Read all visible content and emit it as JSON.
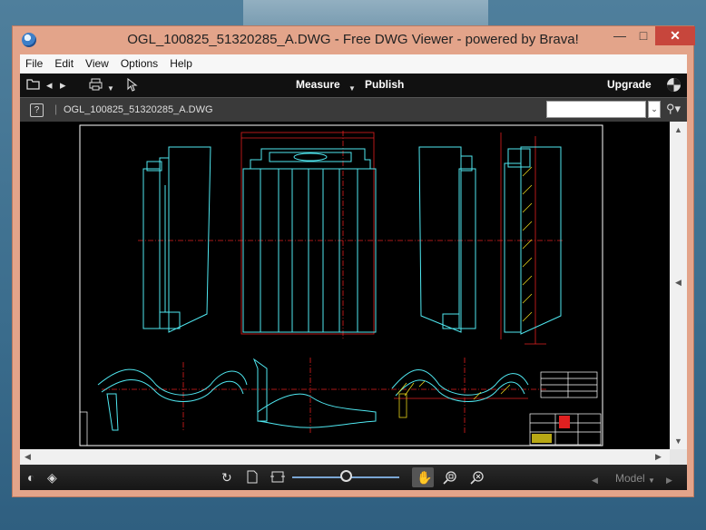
{
  "window": {
    "title": "OGL_100825_51320285_A.DWG - Free DWG Viewer - powered by Brava!",
    "controls": {
      "minimize": "—",
      "maximize": "□",
      "close": "✕"
    }
  },
  "menu": [
    "File",
    "Edit",
    "View",
    "Options",
    "Help"
  ],
  "toolbar": {
    "measure_label": "Measure",
    "publish_label": "Publish",
    "upgrade_label": "Upgrade",
    "icons": [
      "open-folder-icon",
      "back-arrow-icon",
      "forward-arrow-icon",
      "print-icon",
      "pointer-icon",
      "brava-logo-icon"
    ]
  },
  "doc_bar": {
    "filename": "OGL_100825_51320285_A.DWG",
    "search": {
      "value": "",
      "placeholder": ""
    }
  },
  "bottom_bar": {
    "model_label": "Model",
    "zoom_fraction": 0.5,
    "icons": [
      "contrast-icon",
      "layers-icon",
      "rotate-icon",
      "page-icon",
      "fit-icon",
      "pan-hand-icon",
      "zoom-window-icon",
      "zoom-extents-icon"
    ]
  },
  "colors": {
    "drawing_cyan": "#4fe7f0",
    "drawing_red": "#e02020",
    "drawing_white": "#ffffff",
    "drawing_yellow": "#e6d21a",
    "titlebar": "#e3a48a",
    "close_button": "#c7463c"
  }
}
